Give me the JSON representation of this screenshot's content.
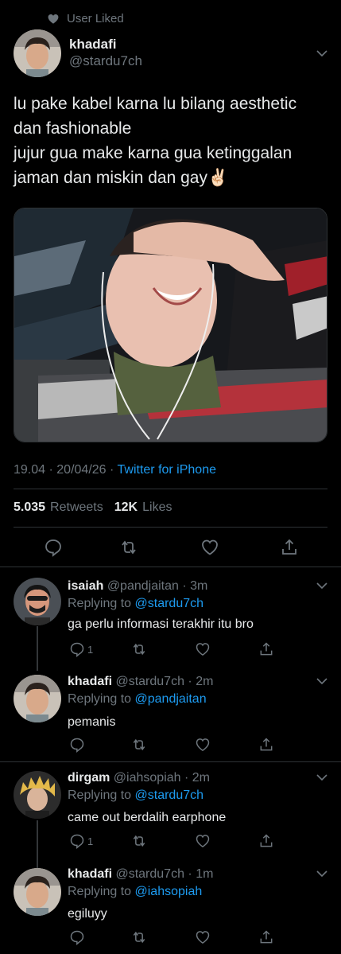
{
  "social_context": {
    "label": "User Liked",
    "icon": "heart-icon"
  },
  "tweet": {
    "author_name": "khadafi",
    "author_handle": "@stardu7ch",
    "text": "lu pake kabel karna lu bilang aesthetic\ndan fashionable\njujur gua make karna gua ketinggalan\njaman dan miskin dan gay✌🏻",
    "time": "19.04",
    "date": "20/04/26",
    "source": "Twitter for iPhone",
    "retweets_count": "5.035",
    "retweets_label": "Retweets",
    "likes_count": "12K",
    "likes_label": "Likes",
    "media": "photo"
  },
  "replies": [
    {
      "name": "isaiah",
      "handle": "@pandjaitan",
      "time": "3m",
      "replying_label": "Replying to",
      "replying_to": "@stardu7ch",
      "text": "ga perlu informasi terakhir itu bro",
      "reply_count": "1"
    },
    {
      "name": "khadafi",
      "handle": "@stardu7ch",
      "time": "2m",
      "replying_label": "Replying to",
      "replying_to": "@pandjaitan",
      "text": "pemanis",
      "reply_count": ""
    },
    {
      "name": "dirgam",
      "handle": "@iahsopiah",
      "time": "2m",
      "replying_label": "Replying to",
      "replying_to": "@stardu7ch",
      "text": "came out berdalih earphone",
      "reply_count": "1"
    },
    {
      "name": "khadafi",
      "handle": "@stardu7ch",
      "time": "1m",
      "replying_label": "Replying to",
      "replying_to": "@iahsopiah",
      "text": "egiluyy",
      "reply_count": ""
    }
  ],
  "colors": {
    "background": "#000000",
    "text": "#e7e9ea",
    "muted": "#6e767d",
    "accent": "#1d9bf0",
    "divider": "#2f3336"
  }
}
